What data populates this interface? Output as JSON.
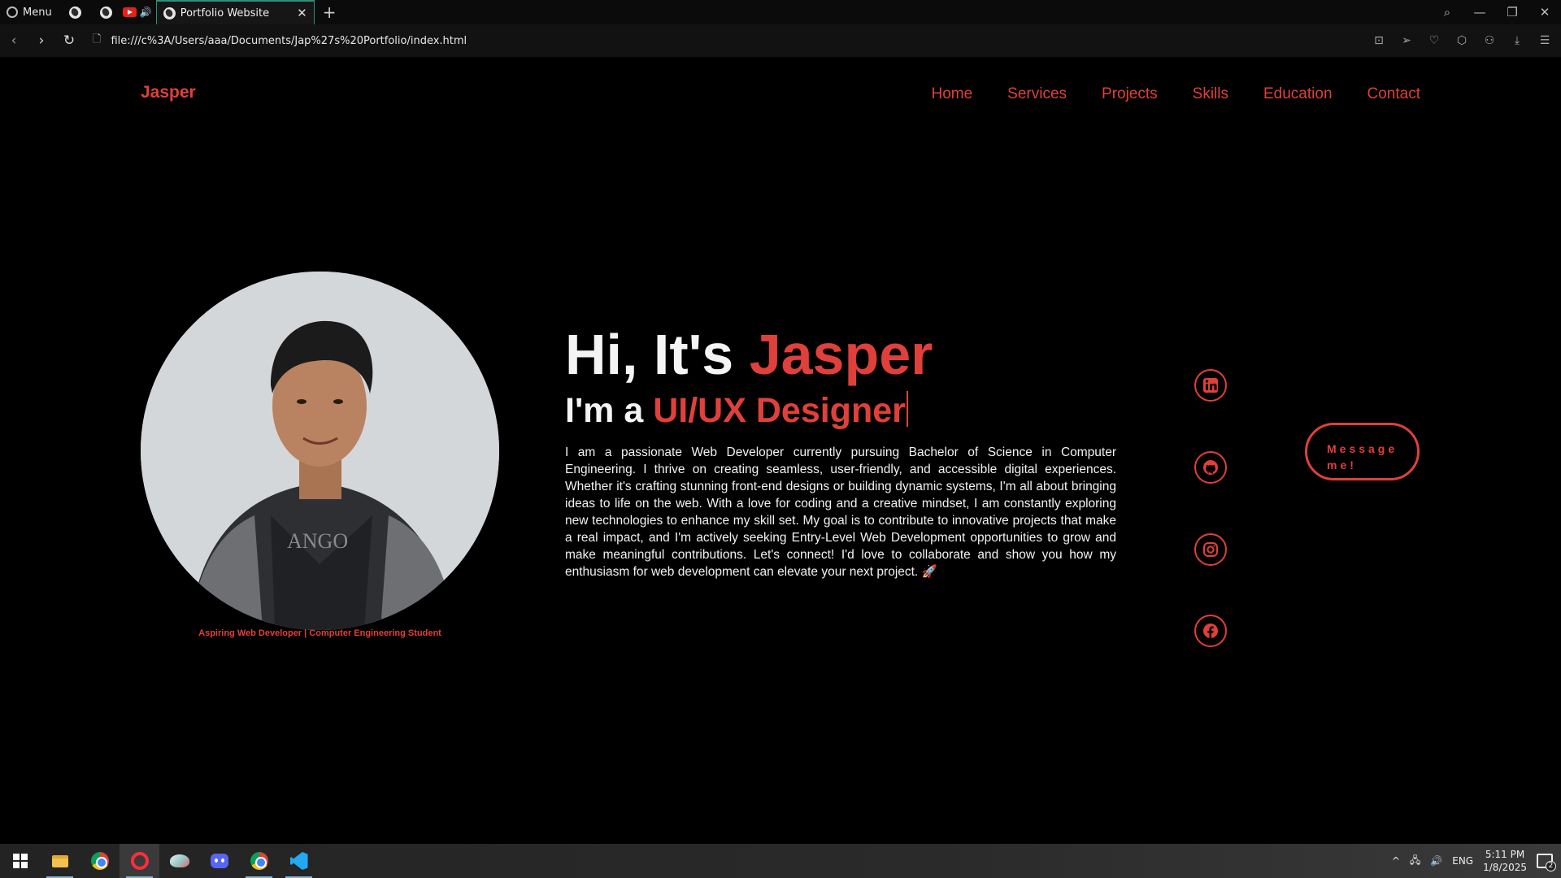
{
  "browser": {
    "menu_label": "Menu",
    "tab_title": "Portfolio Website",
    "tab_close": "✕",
    "new_tab": "+",
    "url": "file:///c%3A/Users/aaa/Documents/Jap%27s%20Portfolio/index.html"
  },
  "site": {
    "logo": "Jasper",
    "nav": [
      "Home",
      "Services",
      "Projects",
      "Skills",
      "Education",
      "Contact"
    ],
    "tagline": "Aspiring Web Developer | Computer Engineering Student",
    "greeting_prefix": "Hi, It's ",
    "greeting_name": "Jasper",
    "role_prefix": "I'm a ",
    "role": "UI/UX Designer",
    "bio": "I am a passionate Web Developer currently pursuing Bachelor of Science in Computer Engineering. I thrive on creating seamless, user-friendly, and accessible digital experiences. Whether it's crafting stunning front-end designs or building dynamic systems, I'm all about bringing ideas to life on the web. With a love for coding and a creative mindset, I am constantly exploring new technologies to enhance my skill set. My goal is to contribute to innovative projects that make a real impact, and I'm actively seeking Entry-Level Web Development opportunities to grow and make meaningful contributions. Let's connect! I'd love to collaborate and show you how my enthusiasm for web development can elevate your next project. 🚀",
    "message_button": "Message me!",
    "socials": [
      "linkedin-icon",
      "github-icon",
      "instagram-icon",
      "facebook-icon"
    ],
    "accent_color": "#e0403b"
  },
  "taskbar": {
    "apps": [
      "start-icon",
      "file-explorer-icon",
      "chrome-icon",
      "opera-icon",
      "paint-icon",
      "discord-icon",
      "chrome-profile-icon",
      "vscode-icon"
    ],
    "language": "ENG",
    "time": "5:11 PM",
    "date": "1/8/2025",
    "notification_count": "2"
  }
}
